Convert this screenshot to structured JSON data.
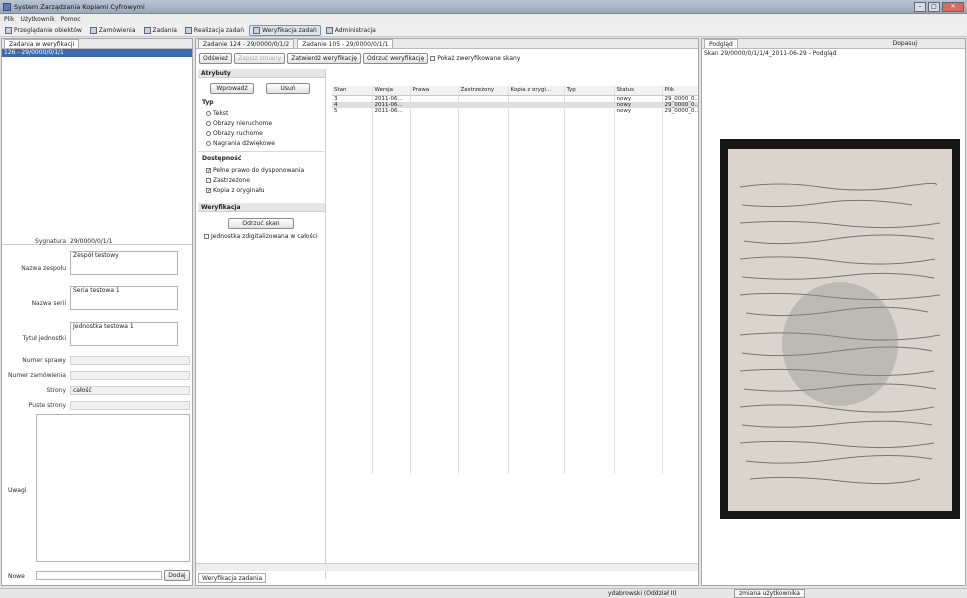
{
  "window": {
    "title": "System Zarządzania Kopiami Cyfrowymi"
  },
  "menu": [
    "Plik",
    "Użytkownik",
    "Pomoc"
  ],
  "toolbar": [
    {
      "label": "Przeglądanie obiektów",
      "icon": "browse-icon"
    },
    {
      "label": "Zamówienia",
      "icon": "orders-icon"
    },
    {
      "label": "Zadania",
      "icon": "tasks-icon"
    },
    {
      "label": "Realizacja zadań",
      "icon": "realization-icon"
    },
    {
      "label": "Weryfikacja zadań",
      "icon": "verification-icon",
      "active": true
    },
    {
      "label": "Administracja",
      "icon": "admin-icon"
    }
  ],
  "left": {
    "tab": "Zadania w weryfikacji",
    "selected_item": "126 - 29/0000/0/1/1",
    "fields": {
      "sygnatura_label": "Sygnatura",
      "sygnatura": "29/0000/0/1/1",
      "zespol_label": "Nazwa zespołu",
      "zespol": "Zespół testowy",
      "seria_label": "Nazwa serii",
      "seria": "Seria testowa 1",
      "jednostka_label": "Tytuł jednostki",
      "jednostka": "Jednostka testowa 1",
      "sprawa_label": "Numer sprawy",
      "zamowienie_label": "Numer zamówienia",
      "strony_label": "Strony",
      "strony": "całość",
      "puste_label": "Puste strony",
      "uwagi_label": "Uwagi",
      "nowe_label": "Nowe",
      "dodaj": "Dodaj"
    }
  },
  "middle": {
    "tabs": [
      "Zadanie 124 - 29/0000/0/1/2",
      "Zadanie 105 - 29/0000/0/1/1"
    ],
    "buttons": {
      "odswiez": "Odśwież",
      "zapisz": "Zapisz zmiany",
      "zatwierdz": "Zatwierdź weryfikację",
      "odrzuc": "Odrzuć weryfikację",
      "pokaz": "Pokaż zweryfikowane skany"
    },
    "atrybuty": {
      "title": "Atrybuty",
      "wprowadz": "Wprowadź",
      "usun": "Usuń",
      "typ_title": "Typ",
      "typ": [
        "Tekst",
        "Obrazy nieruchome",
        "Obrazy ruchome",
        "Nagrania dźwiękowe"
      ],
      "dostepnosc_title": "Dostępność",
      "dostepnosc": [
        "Pełne prawo do dysponowania",
        "Zastrzeżone",
        "Kopia z oryginału"
      ],
      "weryfikacja_title": "Weryfikacja",
      "odrzuc_skan": "Odrzuć skan",
      "jednostka_check": "Jednostka zdigitalizowana w całości"
    },
    "table": {
      "columns": [
        "Stan",
        "Wersja",
        "Prawa",
        "Zastrzeżony",
        "Kopia z orygi...",
        "Typ",
        "Status",
        "Plik"
      ],
      "rows": [
        [
          "3",
          "2011-06...",
          "",
          "",
          "",
          "",
          "nowy",
          "29_0000_0..."
        ],
        [
          "4",
          "2011-06...",
          "",
          "",
          "",
          "",
          "nowy",
          "29_0000_0..."
        ],
        [
          "5",
          "2011-06...",
          "",
          "",
          "",
          "",
          "nowy",
          "29_0000_0..."
        ]
      ]
    },
    "bottom_tab": "Weryfikacja zadania"
  },
  "right": {
    "tab": "Podgląd",
    "caption": "Skan 29/0000/0/1/1/4_2011-06-29 - Podgląd",
    "zoom": "Dopasuj"
  },
  "status": {
    "user": "ydabrowski (Oddział II)",
    "change_user": "zmiana użytkownika"
  }
}
